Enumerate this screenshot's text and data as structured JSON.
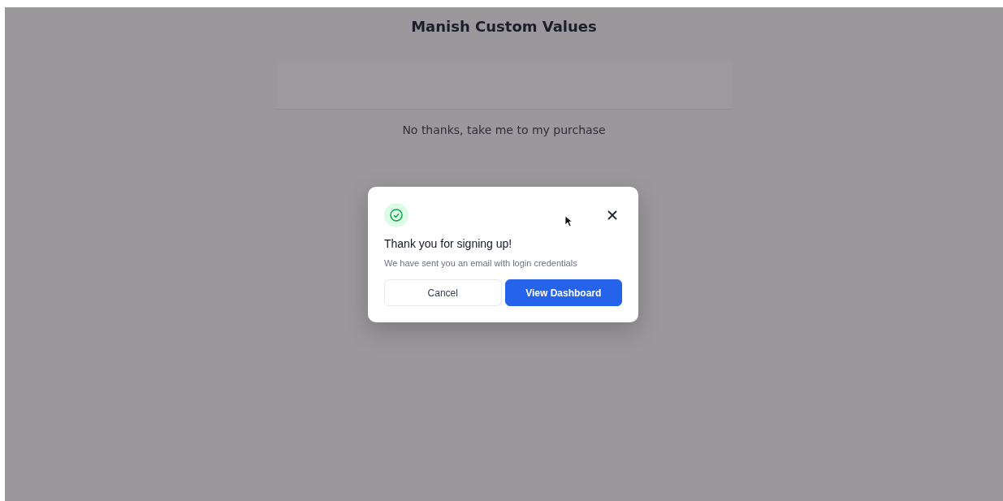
{
  "page": {
    "title": "Manish Custom Values",
    "decline_link": "No thanks, take me to my purchase"
  },
  "dialog": {
    "title": "Thank you for signing up!",
    "message": "We have sent you an email with login credentials",
    "buttons": [
      {
        "label": "Cancel",
        "kind": "secondary"
      },
      {
        "label": "View Dashboard",
        "kind": "primary"
      }
    ]
  }
}
